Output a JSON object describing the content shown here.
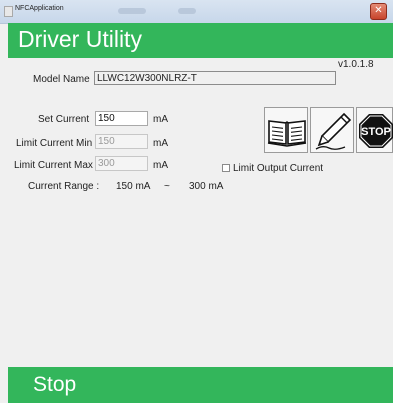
{
  "window": {
    "title": "NFCApplication",
    "close_glyph": "✕"
  },
  "header": {
    "title": "Driver Utility",
    "color": "#33b65b"
  },
  "version": "v1.0.1.8",
  "model": {
    "label": "Model Name",
    "value": "LLWC12W300NLRZ-T"
  },
  "set_current": {
    "label": "Set Current",
    "value": "150",
    "unit": "mA"
  },
  "limit_min": {
    "label": "Limit Current Min",
    "value": "150",
    "unit": "mA"
  },
  "limit_max": {
    "label": "Limit Current Max",
    "value": "300",
    "unit": "mA"
  },
  "current_range": {
    "label": "Current Range :",
    "min": "150 mA",
    "separator": "~",
    "max": "300 mA"
  },
  "limit_output": {
    "label": "Limit Output Current",
    "checked": false
  },
  "toolbar": {
    "read_icon": "book-icon",
    "write_icon": "pencil-icon",
    "stop_icon": "stop-sign-icon",
    "stop_text": "STOP"
  },
  "footer": {
    "label": "Stop"
  }
}
